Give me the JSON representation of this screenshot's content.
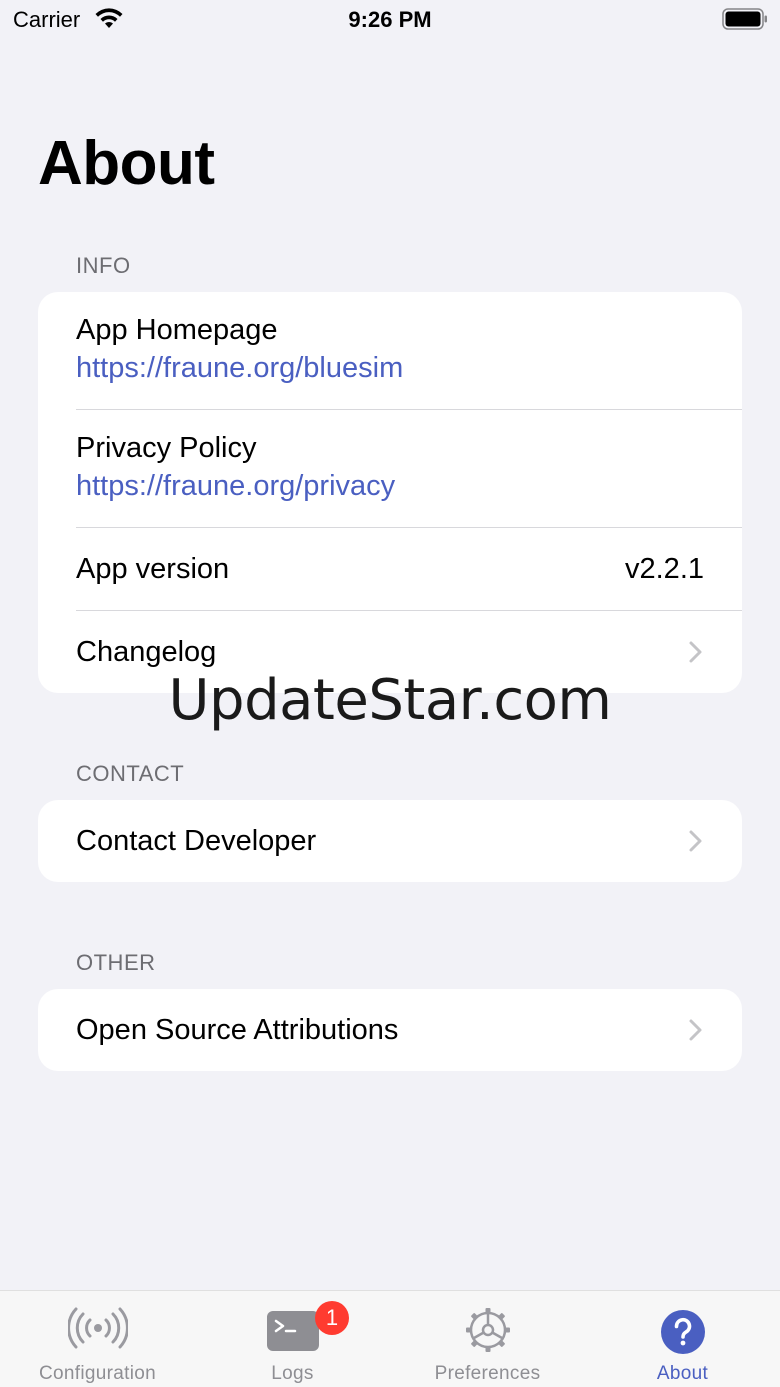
{
  "status_bar": {
    "carrier": "Carrier",
    "time": "9:26 PM"
  },
  "page": {
    "title": "About"
  },
  "sections": {
    "info": {
      "header": "INFO",
      "homepage": {
        "title": "App Homepage",
        "link": "https://fraune.org/bluesim"
      },
      "privacy": {
        "title": "Privacy Policy",
        "link": "https://fraune.org/privacy"
      },
      "version": {
        "title": "App version",
        "value": "v2.2.1"
      },
      "changelog": {
        "title": "Changelog"
      }
    },
    "contact": {
      "header": "CONTACT",
      "developer": {
        "title": "Contact Developer"
      }
    },
    "other": {
      "header": "OTHER",
      "attributions": {
        "title": "Open Source Attributions"
      }
    }
  },
  "watermark": "UpdateStar.com",
  "tab_bar": {
    "tabs": [
      {
        "label": "Configuration",
        "icon": "antenna-icon"
      },
      {
        "label": "Logs",
        "icon": "terminal-icon",
        "badge": "1"
      },
      {
        "label": "Preferences",
        "icon": "gear-icon"
      },
      {
        "label": "About",
        "icon": "question-circle-icon"
      }
    ],
    "active_tab": "About"
  },
  "colors": {
    "accent": "#4a5fc1",
    "background": "#f2f2f7",
    "badge": "#ff3b30",
    "inactive": "#8e8e93"
  }
}
